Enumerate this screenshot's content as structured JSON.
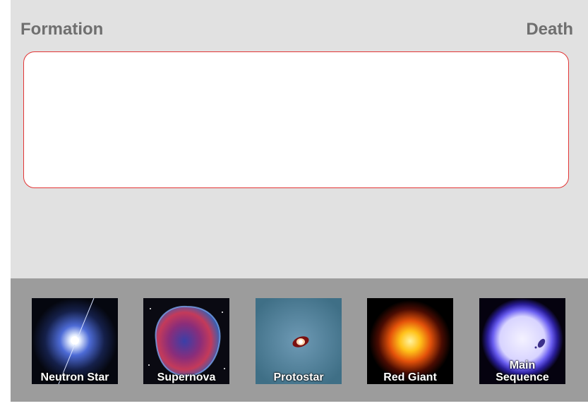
{
  "stage": {
    "left_label": "Formation",
    "right_label": "Death"
  },
  "tray": {
    "cards": [
      {
        "label": "Neutron Star",
        "icon": "neutron-star-icon"
      },
      {
        "label": "Supernova",
        "icon": "supernova-icon"
      },
      {
        "label": "Protostar",
        "icon": "protostar-icon"
      },
      {
        "label": "Red Giant",
        "icon": "red-giant-icon"
      },
      {
        "label_line1": "Main",
        "label_line2": "Sequence",
        "icon": "main-sequence-icon"
      }
    ]
  },
  "colors": {
    "stage_bg": "#e1e1e1",
    "tray_bg": "#9c9c9c",
    "dropzone_border": "#e23535",
    "label_text": "#6f6f6f"
  }
}
